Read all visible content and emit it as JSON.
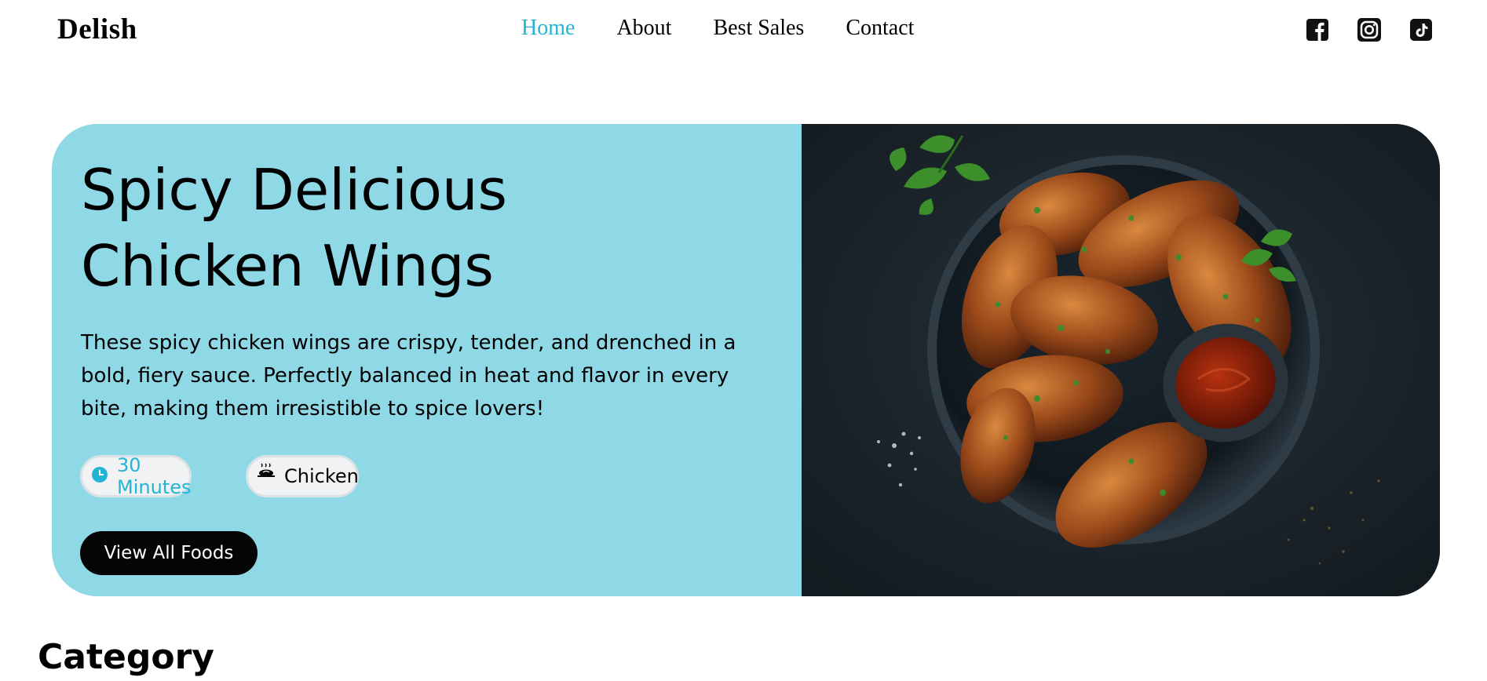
{
  "brand": {
    "logo": "Delish"
  },
  "nav": {
    "items": [
      {
        "label": "Home",
        "active": true
      },
      {
        "label": "About",
        "active": false
      },
      {
        "label": "Best Sales",
        "active": false
      },
      {
        "label": "Contact",
        "active": false
      }
    ]
  },
  "socials": [
    "facebook-icon",
    "instagram-icon",
    "tiktok-icon"
  ],
  "hero": {
    "title_line1": "Spicy Delicious",
    "title_line2": "Chicken Wings",
    "description": "These spicy chicken wings are crispy, tender, and drenched in a bold, fiery sauce. Perfectly balanced in heat and flavor in every bite, making them irresistible to spice lovers!",
    "time_label": "30 Minutes",
    "category_label": "Chicken",
    "cta_label": "View All Foods",
    "image_icon": "chicken-wings-plate-image"
  },
  "section": {
    "category_title": "Category"
  },
  "colors": {
    "accent": "#22b5d3",
    "hero_bg": "#8fd9e7",
    "cta_bg": "#050505"
  }
}
